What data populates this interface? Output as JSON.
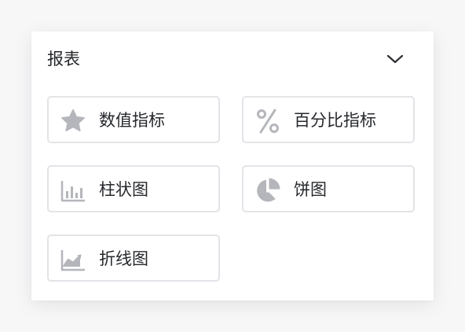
{
  "section": {
    "title": "报表",
    "collapse_icon": "chevron-down-icon"
  },
  "items": [
    {
      "label": "数值指标",
      "icon": "star-icon"
    },
    {
      "label": "百分比指标",
      "icon": "percent-icon"
    },
    {
      "label": "柱状图",
      "icon": "bar-chart-icon"
    },
    {
      "label": "饼图",
      "icon": "pie-chart-icon"
    },
    {
      "label": "折线图",
      "icon": "line-chart-icon"
    }
  ],
  "colors": {
    "icon": "#b4b6bb",
    "text": "#26282c",
    "border": "#e3e4e8",
    "background": "#f7f7f8",
    "panel": "#ffffff"
  }
}
